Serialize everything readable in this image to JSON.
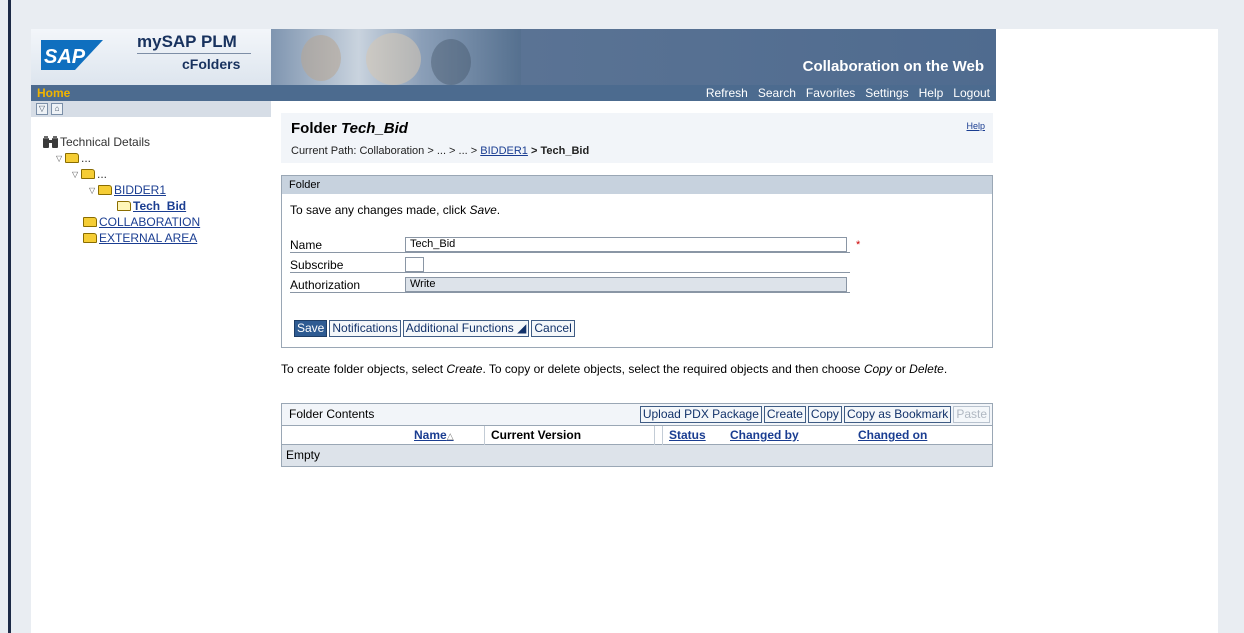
{
  "header": {
    "product_name": "mySAP PLM",
    "product_sub": "cFolders",
    "tagline": "Collaboration on the Web",
    "logo_text": "SAP"
  },
  "nav": {
    "home": "Home",
    "links": [
      "Refresh",
      "Search",
      "Favorites",
      "Settings",
      "Help",
      "Logout"
    ]
  },
  "tree": {
    "root": "Technical Details",
    "level1": "...",
    "level2": "...",
    "bidder": "BIDDER1",
    "current": "Tech_Bid",
    "collaboration": "COLLABORATION",
    "external": "EXTERNAL AREA"
  },
  "page": {
    "title_prefix": "Folder ",
    "title_name": "Tech_Bid",
    "help": "Help",
    "path_prefix": "Current Path:  Collaboration > ... > ... > ",
    "path_link": "BIDDER1",
    "path_current": " > Tech_Bid"
  },
  "folder_box": {
    "heading": "Folder",
    "info_prefix": "To save any changes made, click ",
    "info_emph": "Save",
    "info_suffix": ".",
    "name_label": "Name",
    "name_value": "Tech_Bid",
    "subscribe_label": "Subscribe",
    "subscribe_checked": false,
    "auth_label": "Authorization",
    "auth_value": "Write",
    "required_mark": "*",
    "buttons": {
      "save": "Save",
      "notifications": "Notifications",
      "additional": "Additional Functions ◢",
      "cancel": "Cancel"
    }
  },
  "instructions": {
    "p1": "To create folder objects, select ",
    "e1": "Create",
    "p2": ". To copy or delete objects, select the required objects and then choose ",
    "e2": "Copy",
    "p3": " or ",
    "e3": "Delete",
    "p4": "."
  },
  "contents": {
    "title": "Folder Contents",
    "buttons": {
      "upload": "Upload PDX Package",
      "create": "Create",
      "copy": "Copy",
      "bookmark": "Copy as Bookmark",
      "paste": "Paste"
    },
    "columns": {
      "name": "Name",
      "sort_marker": "△",
      "version": "Current Version",
      "status": "Status",
      "changed_by": "Changed by",
      "changed_on": "Changed on"
    },
    "empty": "Empty"
  },
  "colors": {
    "nav_bg": "#4c6b8f",
    "home": "#f0b400",
    "link": "#1a3d91",
    "primary_button": "#2e5b92"
  }
}
